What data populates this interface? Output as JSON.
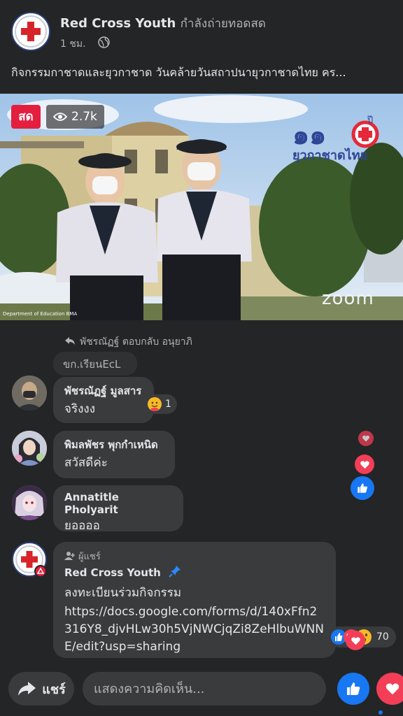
{
  "header": {
    "page_name": "Red Cross Youth",
    "live_status": "กำลังถ่ายทอดสด",
    "time": "1 ชม.",
    "caption": "กิจกรรมกาชาดและยุวกาชาด วันคล้ายวันสถาปนายุวกาชาดไทย คร..."
  },
  "video": {
    "live_label": "สด",
    "viewers": "2.7k",
    "logo_suffix": "ปี",
    "logo_text": "ยุวกาชาดไทย",
    "watermark": "Department of Education BMA",
    "zoom_logo": "zoom"
  },
  "comments": [
    {
      "reply_label": "พัชรณัฏฐ์ ตอบกลับ อนุยาภิ",
      "quoted": "ขก.เรียนEcL",
      "name": "พัชรณัฏฐ์ มูลสาร",
      "text": "จริงงง",
      "reaction_count": "1"
    },
    {
      "name": "พิมลพัชร พุกกำเหนิด",
      "text": "สวัสดีค่ะ"
    },
    {
      "name": "Annatitle Pholyarit",
      "text": "ยออออ"
    },
    {
      "role": "ผู้แชร์",
      "name": "Red Cross Youth",
      "line1": "ลงทะเบียนร่วมกิจกรรม",
      "url": "https://docs.google.com/forms/d/140xFfn2316Y8_djvHLw30h5VjNWCjqZi8ZeHlbuWNNE/edit?usp=sharing",
      "reaction_count": "70"
    }
  ],
  "bottom_bar": {
    "share_label": "แชร์",
    "comment_placeholder": "แสดงความคิดเห็น..."
  },
  "colors": {
    "background": "#242526",
    "bubble": "#3a3b3c",
    "live_red": "#e41e3f",
    "like_blue": "#1877f2",
    "love_red": "#f33e58",
    "red_cross": "#d7242a"
  }
}
